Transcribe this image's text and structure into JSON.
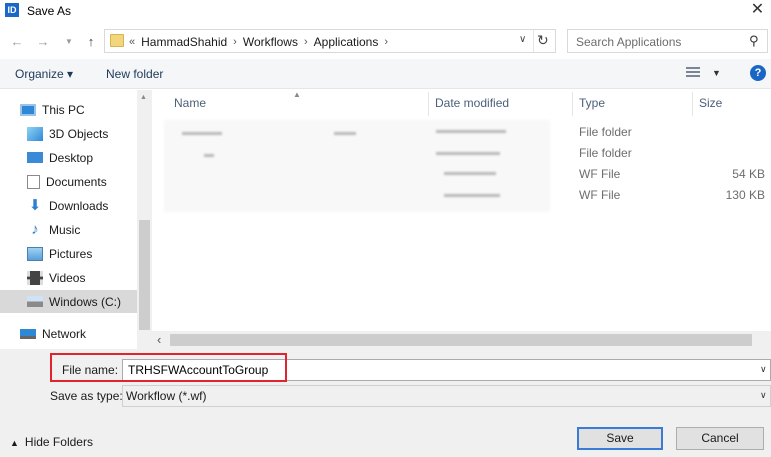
{
  "window": {
    "title": "Save As",
    "app_icon_text": "ID",
    "close_glyph": "✕"
  },
  "address": {
    "overflow": "«",
    "breadcrumbs": [
      "HammadShahid",
      "Workflows",
      "Applications"
    ],
    "search_placeholder": "Search Applications"
  },
  "toolbar": {
    "organize_label": "Organize ▾",
    "new_folder_label": "New folder",
    "help_label": "?"
  },
  "nav": {
    "items": [
      {
        "label": "This PC",
        "icon": "computer-icon"
      },
      {
        "label": "3D Objects",
        "icon": "cube-icon"
      },
      {
        "label": "Desktop",
        "icon": "desktop-icon"
      },
      {
        "label": "Documents",
        "icon": "document-icon"
      },
      {
        "label": "Downloads",
        "icon": "download-icon"
      },
      {
        "label": "Music",
        "icon": "music-icon"
      },
      {
        "label": "Pictures",
        "icon": "pictures-icon"
      },
      {
        "label": "Videos",
        "icon": "video-icon"
      },
      {
        "label": "Windows (C:)",
        "icon": "drive-icon",
        "selected": true
      },
      {
        "label": "Network",
        "icon": "network-icon"
      }
    ]
  },
  "file_list": {
    "columns": {
      "name": "Name",
      "date": "Date modified",
      "type": "Type",
      "size": "Size"
    },
    "rows": [
      {
        "type": "File folder",
        "size": ""
      },
      {
        "type": "File folder",
        "size": ""
      },
      {
        "type": "WF File",
        "size": "54 KB"
      },
      {
        "type": "WF File",
        "size": "130 KB"
      }
    ]
  },
  "bottom": {
    "file_name_label": "File name:",
    "file_name_value": "TRHSFWAccountToGroup",
    "save_type_label": "Save as type:",
    "save_type_value": "Workflow (*.wf)",
    "hide_folders_label": "Hide Folders",
    "save_label": "Save",
    "cancel_label": "Cancel"
  },
  "colors": {
    "accent": "#1a66c6",
    "highlight_border": "#e0242e",
    "selected_nav": "#d9d9d9"
  }
}
